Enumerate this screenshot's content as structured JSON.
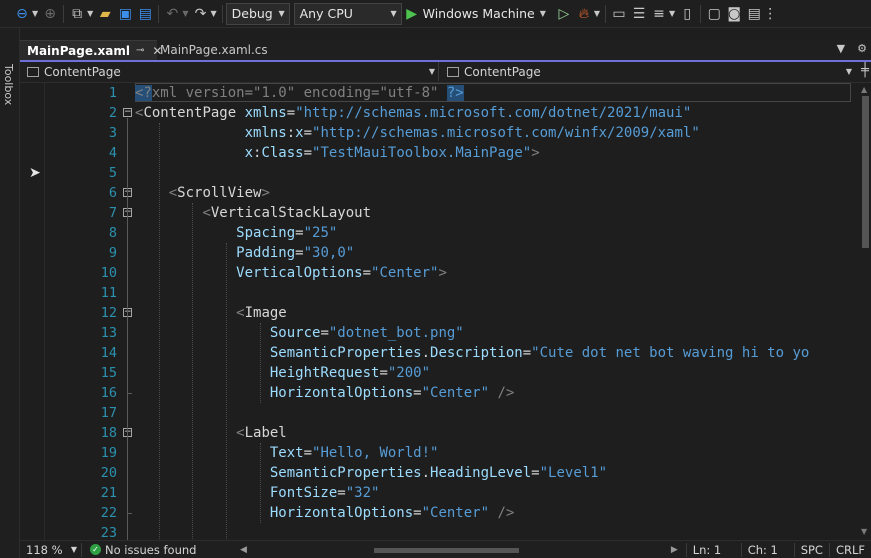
{
  "toolbar": {
    "configuration": "Debug",
    "platform": "Any CPU",
    "run_target": "Windows Machine",
    "icons": [
      "back-icon",
      "forward-icon",
      "new-project-icon",
      "open-icon",
      "save-icon",
      "save-all-icon",
      "undo-icon",
      "redo-icon",
      "run-icon",
      "start-without-debug-icon",
      "hot-reload-icon",
      "solution-explorer-icon",
      "indent-icon",
      "device-icon",
      "camera-icon",
      "terminal-icon",
      "more-icon"
    ]
  },
  "toolbox_label": "Toolbox",
  "tabs": [
    {
      "label": "MainPage.xaml",
      "active": true,
      "pin": "⊸",
      "close": "✕"
    },
    {
      "label": "MainPage.xaml.cs",
      "active": false
    }
  ],
  "navbar": {
    "left": "ContentPage",
    "right": "ContentPage"
  },
  "editor": {
    "line_numbers": [
      "1",
      "2",
      "3",
      "4",
      "5",
      "6",
      "7",
      "8",
      "9",
      "10",
      "11",
      "12",
      "13",
      "14",
      "15",
      "16",
      "17",
      "18",
      "19",
      "20",
      "21",
      "22",
      "23"
    ],
    "lines": [
      [
        [
          "punc",
          "<?"
        ],
        [
          "hl-xml",
          "xml"
        ],
        [
          "punc",
          " version=\"1.0\" encoding=\"utf-8\" "
        ],
        [
          "hl-end",
          "?>"
        ]
      ],
      [
        [
          "br",
          "<"
        ],
        [
          "tag",
          "ContentPage"
        ],
        [
          "sp",
          " "
        ],
        [
          "attr",
          "xmlns"
        ],
        [
          "eq",
          "="
        ],
        [
          "val",
          "\"http://schemas.microsoft.com/dotnet/2021/maui\""
        ]
      ],
      [
        [
          "sp",
          "             "
        ],
        [
          "attr",
          "xmlns"
        ],
        [
          "eq",
          ":"
        ],
        [
          "attr",
          "x"
        ],
        [
          "eq",
          "="
        ],
        [
          "val",
          "\"http://schemas.microsoft.com/winfx/2009/xaml\""
        ]
      ],
      [
        [
          "sp",
          "             "
        ],
        [
          "attr",
          "x"
        ],
        [
          "eq",
          ":"
        ],
        [
          "attr",
          "Class"
        ],
        [
          "eq",
          "="
        ],
        [
          "val",
          "\"TestMauiToolbox.MainPage\""
        ],
        [
          "br",
          ">"
        ]
      ],
      [],
      [
        [
          "sp",
          "    "
        ],
        [
          "br",
          "<"
        ],
        [
          "tag",
          "ScrollView"
        ],
        [
          "br",
          ">"
        ]
      ],
      [
        [
          "sp",
          "        "
        ],
        [
          "br",
          "<"
        ],
        [
          "tag",
          "VerticalStackLayout"
        ]
      ],
      [
        [
          "sp",
          "            "
        ],
        [
          "attr",
          "Spacing"
        ],
        [
          "eq",
          "="
        ],
        [
          "val",
          "\"25\""
        ]
      ],
      [
        [
          "sp",
          "            "
        ],
        [
          "attr",
          "Padding"
        ],
        [
          "eq",
          "="
        ],
        [
          "val",
          "\"30,0\""
        ]
      ],
      [
        [
          "sp",
          "            "
        ],
        [
          "attr",
          "VerticalOptions"
        ],
        [
          "eq",
          "="
        ],
        [
          "val",
          "\"Center\""
        ],
        [
          "br",
          ">"
        ]
      ],
      [],
      [
        [
          "sp",
          "            "
        ],
        [
          "br",
          "<"
        ],
        [
          "tag",
          "Image"
        ]
      ],
      [
        [
          "sp",
          "                "
        ],
        [
          "attr",
          "Source"
        ],
        [
          "eq",
          "="
        ],
        [
          "val",
          "\"dotnet_bot.png\""
        ]
      ],
      [
        [
          "sp",
          "                "
        ],
        [
          "attr",
          "SemanticProperties"
        ],
        [
          "eq",
          "."
        ],
        [
          "attr",
          "Description"
        ],
        [
          "eq",
          "="
        ],
        [
          "val",
          "\"Cute dot net bot waving hi to yo"
        ]
      ],
      [
        [
          "sp",
          "                "
        ],
        [
          "attr",
          "HeightRequest"
        ],
        [
          "eq",
          "="
        ],
        [
          "val",
          "\"200\""
        ]
      ],
      [
        [
          "sp",
          "                "
        ],
        [
          "attr",
          "HorizontalOptions"
        ],
        [
          "eq",
          "="
        ],
        [
          "val",
          "\"Center\""
        ],
        [
          "br",
          " />"
        ]
      ],
      [],
      [
        [
          "sp",
          "            "
        ],
        [
          "br",
          "<"
        ],
        [
          "tag",
          "Label"
        ]
      ],
      [
        [
          "sp",
          "                "
        ],
        [
          "attr",
          "Text"
        ],
        [
          "eq",
          "="
        ],
        [
          "val",
          "\"Hello, World!\""
        ]
      ],
      [
        [
          "sp",
          "                "
        ],
        [
          "attr",
          "SemanticProperties"
        ],
        [
          "eq",
          "."
        ],
        [
          "attr",
          "HeadingLevel"
        ],
        [
          "eq",
          "="
        ],
        [
          "val",
          "\"Level1\""
        ]
      ],
      [
        [
          "sp",
          "                "
        ],
        [
          "attr",
          "FontSize"
        ],
        [
          "eq",
          "="
        ],
        [
          "val",
          "\"32\""
        ]
      ],
      [
        [
          "sp",
          "                "
        ],
        [
          "attr",
          "HorizontalOptions"
        ],
        [
          "eq",
          "="
        ],
        [
          "val",
          "\"Center\""
        ],
        [
          "br",
          " />"
        ]
      ],
      []
    ]
  },
  "statusbar": {
    "zoom": "118 %",
    "issues": "No issues found",
    "line": "Ln: 1",
    "col": "Ch: 1",
    "whitespace": "SPC",
    "line_ending": "CRLF"
  },
  "colors": {
    "line_number": "#2b91af",
    "attribute": "#9cdcfe",
    "value": "#569cd6",
    "tag": "#d7d7d7",
    "punct": "#808080",
    "tab_accent": "#6f6fd9"
  }
}
